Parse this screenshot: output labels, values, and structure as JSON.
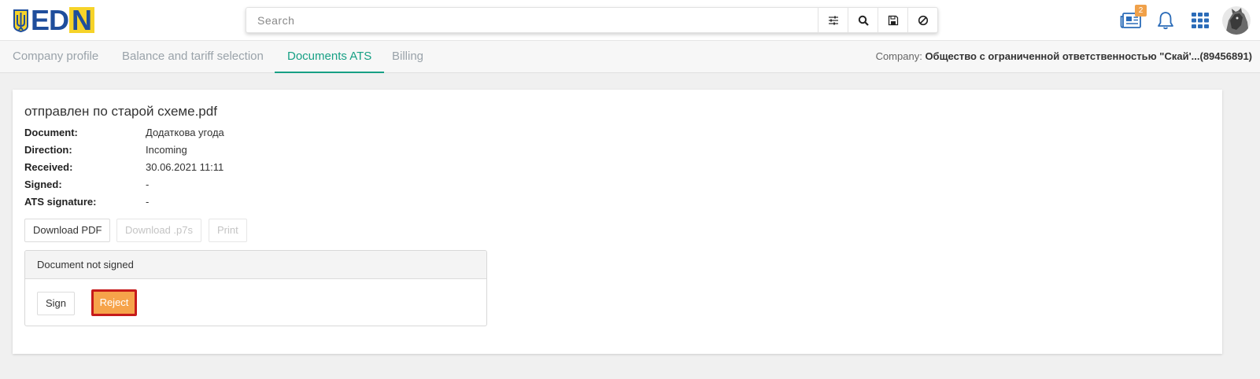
{
  "header": {
    "logo_text": "ED",
    "logo_n": "N",
    "search_placeholder": "Search",
    "search_buttons": [
      "filter-icon",
      "search-icon",
      "save-icon",
      "cancel-icon"
    ],
    "news_badge": "2"
  },
  "tabs": [
    {
      "label": "Company profile"
    },
    {
      "label": "Balance and tariff selection"
    },
    {
      "label": "Documents ATS",
      "active": true
    },
    {
      "label": "Billing"
    }
  ],
  "company": {
    "label": "Company:",
    "value": "Общество с ограниченной ответственностью \"Скай'...(89456891)"
  },
  "document": {
    "title": "отправлен по старой схеме.pdf",
    "fields": [
      {
        "label": "Document:",
        "value": "Додаткова угода"
      },
      {
        "label": "Direction:",
        "value": "Incoming"
      },
      {
        "label": "Received:",
        "value": "30.06.2021 11:11"
      },
      {
        "label": "Signed:",
        "value": "-"
      },
      {
        "label": "ATS signature:",
        "value": "-"
      }
    ],
    "download_pdf": "Download PDF",
    "download_p7s": "Download .p7s",
    "print": "Print"
  },
  "sign_panel": {
    "status": "Document not signed",
    "sign_label": "Sign",
    "reject_label": "Reject"
  },
  "colors": {
    "accent": "#17a085",
    "logo_blue": "#1f4e9c",
    "logo_yellow": "#f6d329",
    "badge": "#f0a14a",
    "reject_bg": "#f6a34a",
    "reject_border": "#c61a1a"
  }
}
